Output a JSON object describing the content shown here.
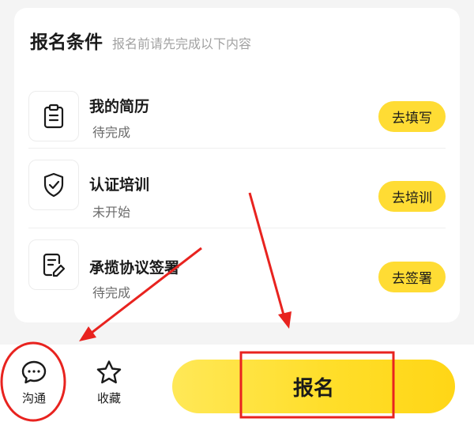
{
  "card": {
    "title": "报名条件",
    "subtitle": "报名前请先完成以下内容",
    "items": [
      {
        "title": "我的简历",
        "status": "待完成",
        "action": "去填写",
        "icon": "clipboard-icon"
      },
      {
        "title": "认证培训",
        "status": "未开始",
        "action": "去培训",
        "icon": "shield-check-icon"
      },
      {
        "title": "承揽协议签署",
        "status": "待完成",
        "action": "去签署",
        "icon": "document-edit-icon"
      }
    ]
  },
  "bottom_bar": {
    "chat_label": "沟通",
    "favorite_label": "收藏",
    "signup_label": "报名"
  },
  "colors": {
    "accent": "#ffdc34",
    "annotation": "#e8231f"
  }
}
